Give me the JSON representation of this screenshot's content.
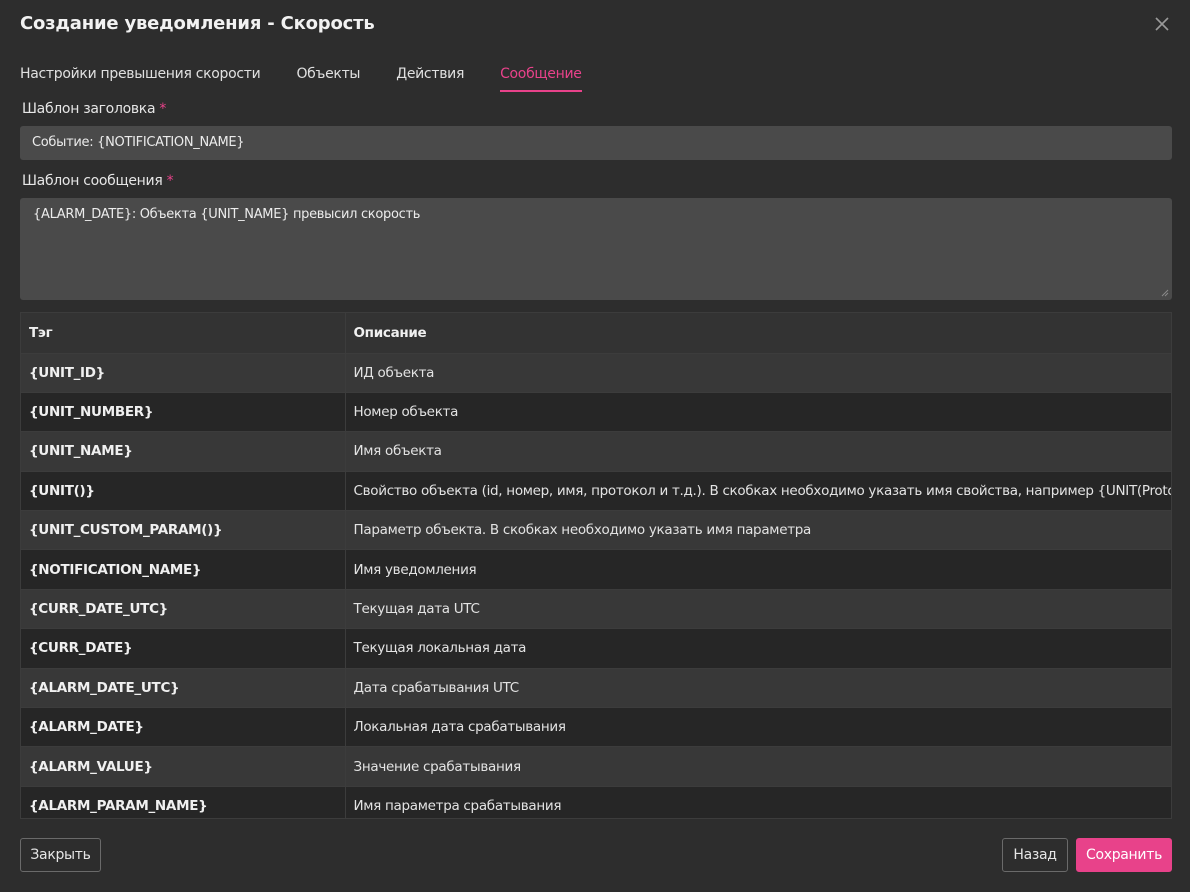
{
  "dialog": {
    "title": "Создание уведомления - Скорость",
    "close_icon": "close-icon"
  },
  "tabs": [
    {
      "label": "Настройки превышения скорости",
      "active": false
    },
    {
      "label": "Объекты",
      "active": false
    },
    {
      "label": "Действия",
      "active": false
    },
    {
      "label": "Сообщение",
      "active": true
    }
  ],
  "form": {
    "title_template": {
      "label": "Шаблон заголовка",
      "required_mark": "*",
      "value": "Событие: {NOTIFICATION_NAME}"
    },
    "message_template": {
      "label": "Шаблон сообщения",
      "required_mark": "*",
      "value": "{ALARM_DATE}: Объекта {UNIT_NAME} превысил скорость"
    }
  },
  "tags_table": {
    "columns": [
      "Тэг",
      "Описание"
    ],
    "rows": [
      {
        "tag": "{UNIT_ID}",
        "desc": "ИД объекта"
      },
      {
        "tag": "{UNIT_NUMBER}",
        "desc": "Номер объекта"
      },
      {
        "tag": "{UNIT_NAME}",
        "desc": "Имя объекта"
      },
      {
        "tag": "{UNIT()}",
        "desc": "Свойство объекта (id, номер, имя, протокол и т.д.). В скобках необходимо указать имя свойства, например {UNIT(Protocol)}"
      },
      {
        "tag": "{UNIT_CUSTOM_PARAM()}",
        "desc": "Параметр объекта. В скобках необходимо указать имя параметра"
      },
      {
        "tag": "{NOTIFICATION_NAME}",
        "desc": "Имя уведомления"
      },
      {
        "tag": "{CURR_DATE_UTC}",
        "desc": "Текущая дата UTC"
      },
      {
        "tag": "{CURR_DATE}",
        "desc": "Текущая локальная дата"
      },
      {
        "tag": "{ALARM_DATE_UTC}",
        "desc": "Дата срабатывания UTC"
      },
      {
        "tag": "{ALARM_DATE}",
        "desc": "Локальная дата срабатывания"
      },
      {
        "tag": "{ALARM_VALUE}",
        "desc": "Значение срабатывания"
      },
      {
        "tag": "{ALARM_PARAM_NAME}",
        "desc": "Имя параметра срабатывания"
      }
    ]
  },
  "footer": {
    "close_label": "Закрыть",
    "back_label": "Назад",
    "save_label": "Сохранить"
  },
  "colors": {
    "accent": "#e8428a",
    "background": "#2d2d2d",
    "input_bg": "#4a4a4a"
  }
}
